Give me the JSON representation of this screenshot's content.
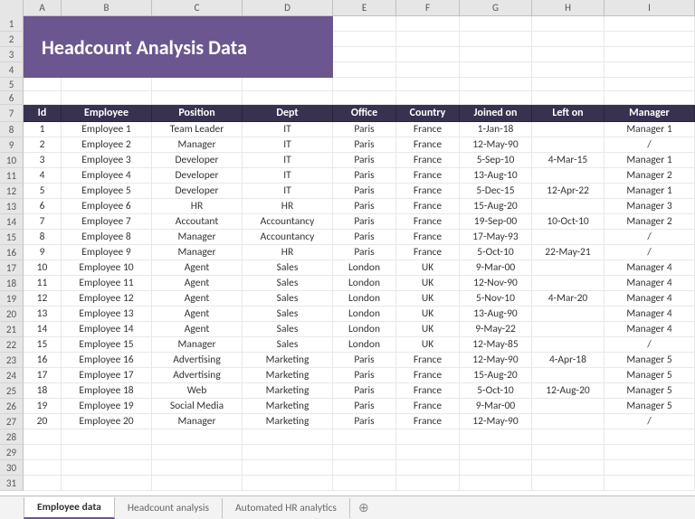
{
  "title": "Headcount Analysis Data",
  "columns": [
    "A",
    "B",
    "C",
    "D",
    "E",
    "F",
    "G",
    "H",
    "I"
  ],
  "tableHeaders": [
    "Id",
    "Employee",
    "Position",
    "Dept",
    "Office",
    "Country",
    "Joined on",
    "Left on",
    "Manager"
  ],
  "rows": [
    {
      "id": "1",
      "employee": "Employee 1",
      "position": "Team Leader",
      "dept": "IT",
      "office": "Paris",
      "country": "France",
      "joined": "1-Jan-18",
      "left": "",
      "manager": "Manager 1"
    },
    {
      "id": "2",
      "employee": "Employee 2",
      "position": "Manager",
      "dept": "IT",
      "office": "Paris",
      "country": "France",
      "joined": "12-May-90",
      "left": "",
      "manager": "/"
    },
    {
      "id": "3",
      "employee": "Employee 3",
      "position": "Developer",
      "dept": "IT",
      "office": "Paris",
      "country": "France",
      "joined": "5-Sep-10",
      "left": "4-Mar-15",
      "manager": "Manager 1"
    },
    {
      "id": "4",
      "employee": "Employee 4",
      "position": "Developer",
      "dept": "IT",
      "office": "Paris",
      "country": "France",
      "joined": "13-Aug-10",
      "left": "",
      "manager": "Manager 2"
    },
    {
      "id": "5",
      "employee": "Employee 5",
      "position": "Developer",
      "dept": "IT",
      "office": "Paris",
      "country": "France",
      "joined": "5-Dec-15",
      "left": "12-Apr-22",
      "manager": "Manager 1"
    },
    {
      "id": "6",
      "employee": "Employee 6",
      "position": "HR",
      "dept": "HR",
      "office": "Paris",
      "country": "France",
      "joined": "15-Aug-20",
      "left": "",
      "manager": "Manager 3"
    },
    {
      "id": "7",
      "employee": "Employee 7",
      "position": "Accoutant",
      "dept": "Accountancy",
      "office": "Paris",
      "country": "France",
      "joined": "19-Sep-00",
      "left": "10-Oct-10",
      "manager": "Manager 2"
    },
    {
      "id": "8",
      "employee": "Employee 8",
      "position": "Manager",
      "dept": "Accountancy",
      "office": "Paris",
      "country": "France",
      "joined": "17-May-93",
      "left": "",
      "manager": "/"
    },
    {
      "id": "9",
      "employee": "Employee 9",
      "position": "Manager",
      "dept": "HR",
      "office": "Paris",
      "country": "France",
      "joined": "5-Oct-10",
      "left": "22-May-21",
      "manager": "/"
    },
    {
      "id": "10",
      "employee": "Employee 10",
      "position": "Agent",
      "dept": "Sales",
      "office": "London",
      "country": "UK",
      "joined": "9-Mar-00",
      "left": "",
      "manager": "Manager 4"
    },
    {
      "id": "11",
      "employee": "Employee 11",
      "position": "Agent",
      "dept": "Sales",
      "office": "London",
      "country": "UK",
      "joined": "12-Nov-90",
      "left": "",
      "manager": "Manager 4"
    },
    {
      "id": "12",
      "employee": "Employee 12",
      "position": "Agent",
      "dept": "Sales",
      "office": "London",
      "country": "UK",
      "joined": "5-Nov-10",
      "left": "4-Mar-20",
      "manager": "Manager 4"
    },
    {
      "id": "13",
      "employee": "Employee 13",
      "position": "Agent",
      "dept": "Sales",
      "office": "London",
      "country": "UK",
      "joined": "13-Aug-90",
      "left": "",
      "manager": "Manager 4"
    },
    {
      "id": "14",
      "employee": "Employee 14",
      "position": "Agent",
      "dept": "Sales",
      "office": "London",
      "country": "UK",
      "joined": "9-May-22",
      "left": "",
      "manager": "Manager 4"
    },
    {
      "id": "15",
      "employee": "Employee 15",
      "position": "Manager",
      "dept": "Sales",
      "office": "London",
      "country": "UK",
      "joined": "12-May-85",
      "left": "",
      "manager": "/"
    },
    {
      "id": "16",
      "employee": "Employee 16",
      "position": "Advertising",
      "dept": "Marketing",
      "office": "Paris",
      "country": "France",
      "joined": "12-May-90",
      "left": "4-Apr-18",
      "manager": "Manager 5"
    },
    {
      "id": "17",
      "employee": "Employee 17",
      "position": "Advertising",
      "dept": "Marketing",
      "office": "Paris",
      "country": "France",
      "joined": "15-Aug-20",
      "left": "",
      "manager": "Manager 5"
    },
    {
      "id": "18",
      "employee": "Employee 18",
      "position": "Web",
      "dept": "Marketing",
      "office": "Paris",
      "country": "France",
      "joined": "5-Oct-10",
      "left": "12-Aug-20",
      "manager": "Manager 5"
    },
    {
      "id": "19",
      "employee": "Employee 19",
      "position": "Social Media",
      "dept": "Marketing",
      "office": "Paris",
      "country": "France",
      "joined": "9-Mar-00",
      "left": "",
      "manager": "Manager 5"
    },
    {
      "id": "20",
      "employee": "Employee 20",
      "position": "Manager",
      "dept": "Marketing",
      "office": "Paris",
      "country": "France",
      "joined": "12-May-90",
      "left": "",
      "manager": "/"
    }
  ],
  "sheetTabs": [
    "Employee data",
    "Headcount analysis",
    "Automated HR analytics"
  ],
  "activeTab": 0,
  "rowNumbers": {
    "title_start": 1,
    "title_rows": 4,
    "gap_rows": [
      5,
      6
    ],
    "header_row": 7,
    "data_start": 8,
    "trailing": [
      28,
      29,
      30,
      31
    ]
  },
  "colors": {
    "banner": "#6b568f",
    "header_bg": "#38314f"
  }
}
